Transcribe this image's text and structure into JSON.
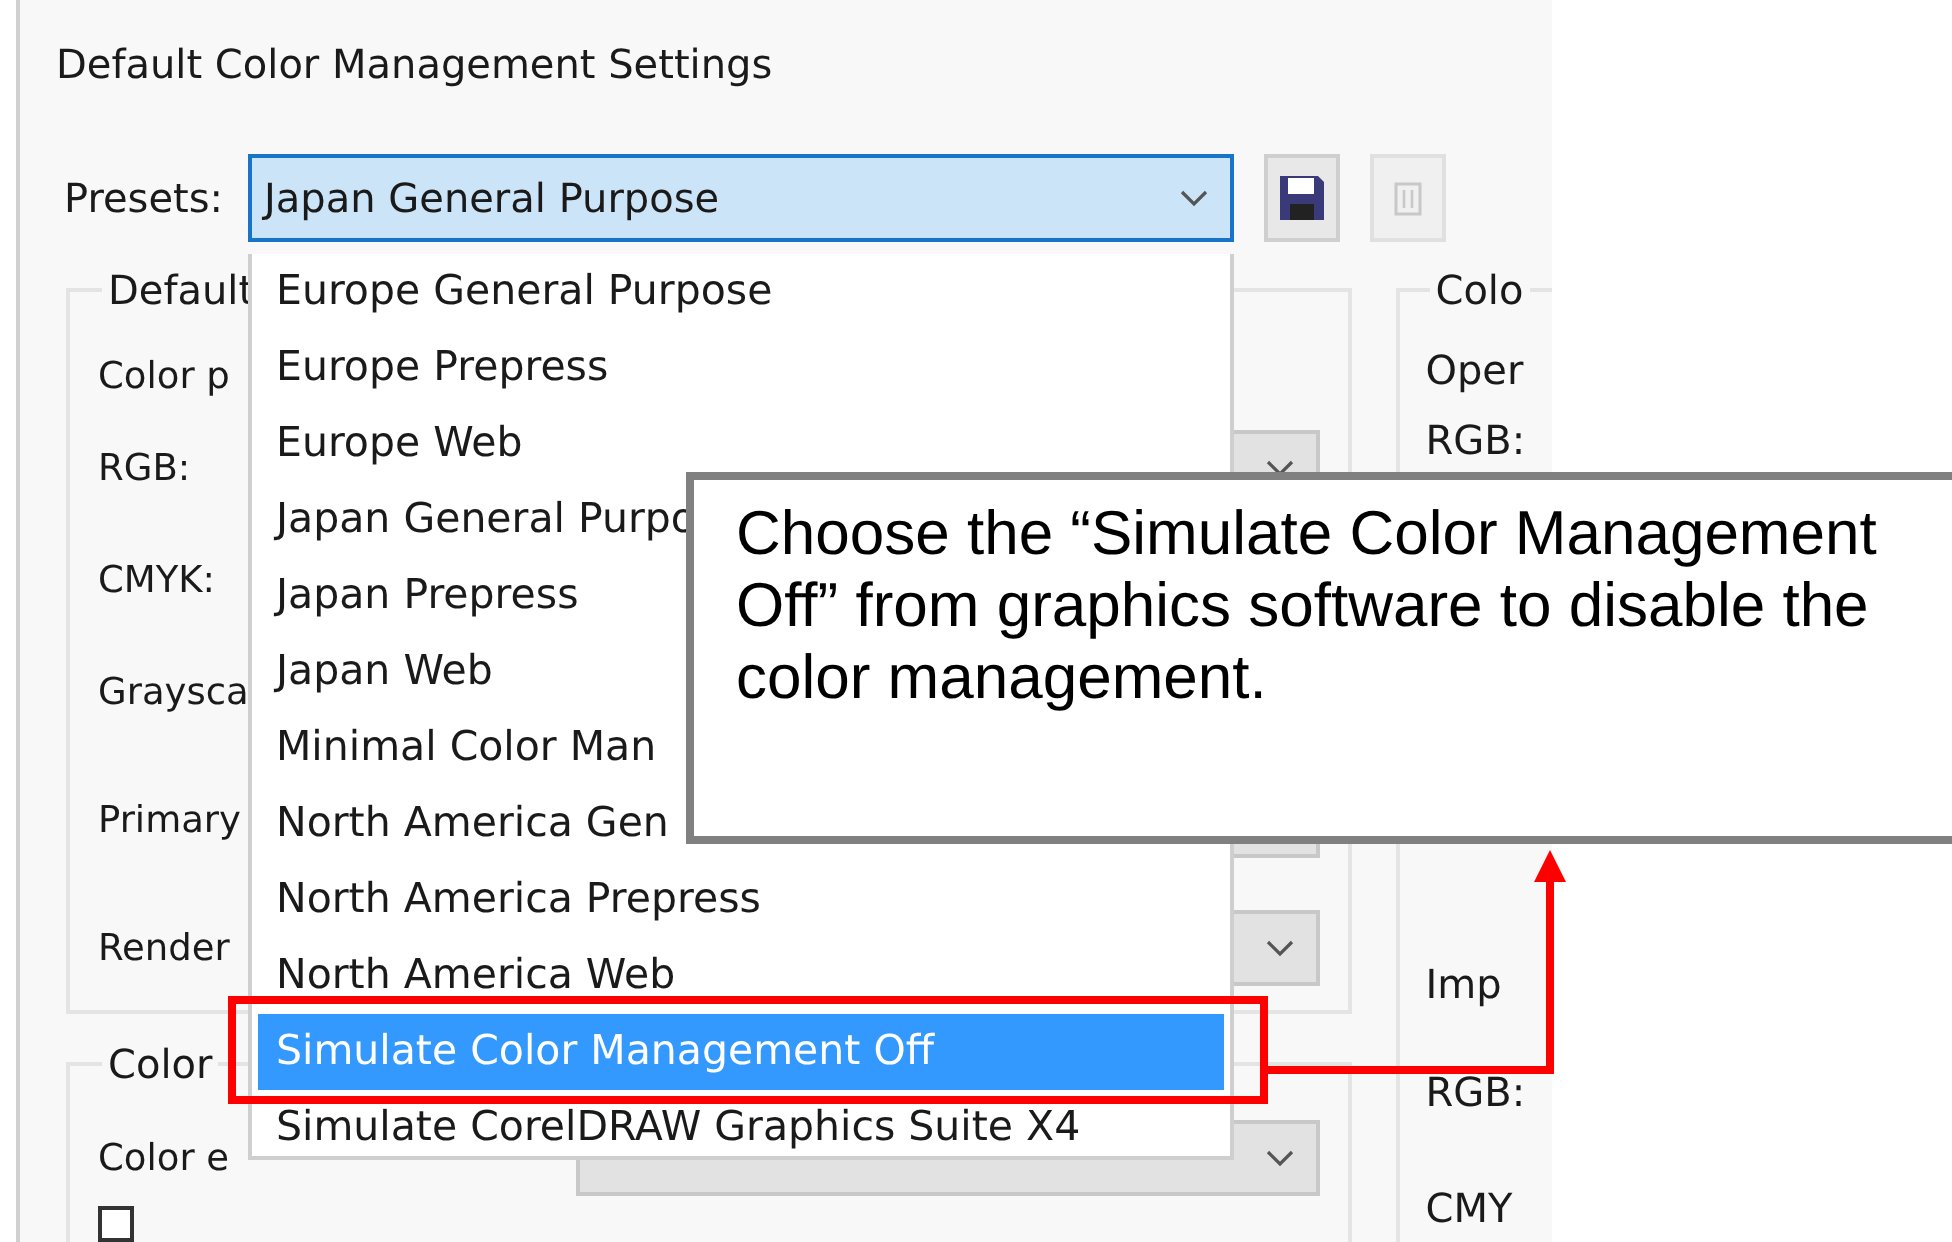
{
  "dialog": {
    "title": "Default Color Management Settings",
    "presets": {
      "label": "Presets:",
      "value": "Japan General Purpose",
      "expanded": true
    },
    "buttons": [
      {
        "kind": "save",
        "disabled": false
      },
      {
        "kind": "delete",
        "disabled": true
      }
    ],
    "left_groups": [
      {
        "title": "Default",
        "rows": [
          {
            "kind": "label",
            "label": "Color p"
          },
          {
            "kind": "combo",
            "label": "RGB:"
          },
          {
            "kind": "combo",
            "label": "CMYK:"
          },
          {
            "kind": "combo",
            "label": "Graysca"
          },
          {
            "kind": "combo",
            "label": "Primary"
          },
          {
            "kind": "combo",
            "label": "Render"
          }
        ]
      },
      {
        "title": "Color",
        "rows": [
          {
            "kind": "combo",
            "label": "Color e"
          },
          {
            "kind": "checkbox",
            "checked": false
          }
        ]
      }
    ],
    "right_group": {
      "title": "Colo",
      "sections": [
        [
          "Oper",
          "RGB:"
        ],
        [
          "Imp",
          "RGB:",
          "CMY"
        ]
      ]
    }
  },
  "dropdown": {
    "items": [
      {
        "label": "Europe General Purpose",
        "selected": false
      },
      {
        "label": "Europe Prepress",
        "selected": false
      },
      {
        "label": "Europe Web",
        "selected": false
      },
      {
        "label": "Japan General Purpo",
        "selected": false
      },
      {
        "label": "Japan Prepress",
        "selected": false
      },
      {
        "label": "Japan Web",
        "selected": false
      },
      {
        "label": "Minimal Color Man",
        "selected": false
      },
      {
        "label": "North America Gen",
        "selected": false
      },
      {
        "label": "North America Prepress",
        "selected": false
      },
      {
        "label": "North America Web",
        "selected": false
      },
      {
        "label": "Simulate Color Management Off",
        "selected": true
      },
      {
        "label": "Simulate CorelDRAW Graphics Suite X4",
        "selected": false
      }
    ]
  },
  "callout": {
    "text": "Choose the “Simulate Color Management Off” from graphics software to disable the color management."
  }
}
